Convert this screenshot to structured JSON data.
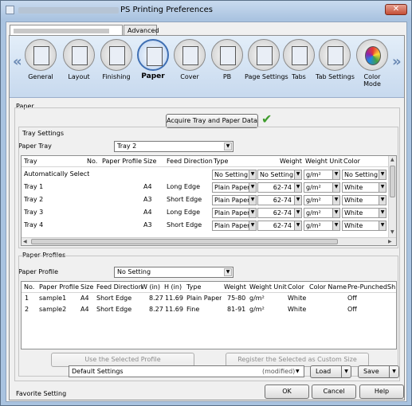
{
  "window": {
    "title": "PS Printing Preferences",
    "close_glyph": "✕"
  },
  "tabs": [
    {
      "label": "Advanced"
    }
  ],
  "iconbar": {
    "left_arrow": "«",
    "right_arrow": "»",
    "items": [
      {
        "label": "General"
      },
      {
        "label": "Layout"
      },
      {
        "label": "Finishing"
      },
      {
        "label": "Paper"
      },
      {
        "label": "Cover"
      },
      {
        "label": "PB"
      },
      {
        "label": "Page Settings"
      },
      {
        "label": "Tabs"
      },
      {
        "label": "Tab Settings"
      },
      {
        "label": "Color\nMode"
      }
    ]
  },
  "paper": {
    "group_label": "Paper",
    "acquire_button": "Acquire Tray and Paper Data",
    "check_glyph": "✔",
    "tray_settings_label": "Tray Settings",
    "paper_tray_label": "Paper Tray",
    "paper_tray_value": "Tray 2",
    "tray_table": {
      "columns": [
        "Tray",
        "No.",
        "Paper Profile",
        "Size",
        "Feed Direction",
        "Type",
        "Weight",
        "Weight Unit",
        "Color"
      ],
      "rows": [
        {
          "tray": "Automatically Select",
          "no": "",
          "profile": "",
          "size": "",
          "feed": "",
          "type": "No Setting",
          "weight": "No Setting",
          "unit": "g/m²",
          "color": "No Setting"
        },
        {
          "tray": "Tray 1",
          "no": "",
          "profile": "",
          "size": "A4",
          "feed": "Long Edge",
          "type": "Plain Paper",
          "weight": "62-74",
          "unit": "g/m²",
          "color": "White"
        },
        {
          "tray": "Tray 2",
          "no": "",
          "profile": "",
          "size": "A3",
          "feed": "Short Edge",
          "type": "Plain Paper",
          "weight": "62-74",
          "unit": "g/m²",
          "color": "White"
        },
        {
          "tray": "Tray 3",
          "no": "",
          "profile": "",
          "size": "A4",
          "feed": "Long Edge",
          "type": "Plain Paper",
          "weight": "62-74",
          "unit": "g/m²",
          "color": "White"
        },
        {
          "tray": "Tray 4",
          "no": "",
          "profile": "",
          "size": "A3",
          "feed": "Short Edge",
          "type": "Plain Paper",
          "weight": "62-74",
          "unit": "g/m²",
          "color": "White"
        }
      ]
    },
    "profiles_label": "Paper Profiles",
    "paper_profile_label": "Paper Profile",
    "paper_profile_value": "No Setting",
    "profile_table": {
      "columns": [
        "No.",
        "Paper Profile",
        "Size",
        "Feed Direction",
        "W (in)",
        "H (in)",
        "Type",
        "Weight",
        "Weight Unit",
        "Color",
        "Color Name",
        "Pre-Punched",
        "Sh"
      ],
      "rows": [
        {
          "no": "1",
          "profile": "sample1",
          "size": "A4",
          "feed": "Short Edge",
          "w": "8.27",
          "h": "11.69",
          "type": "Plain Paper",
          "weight": "75-80",
          "unit": "g/m²",
          "color": "White",
          "cname": "",
          "punched": "Off"
        },
        {
          "no": "2",
          "profile": "sample2",
          "size": "A4",
          "feed": "Short Edge",
          "w": "8.27",
          "h": "11.69",
          "type": "Fine",
          "weight": "81-91",
          "unit": "g/m²",
          "color": "White",
          "cname": "",
          "punched": "Off"
        }
      ]
    },
    "use_selected": "Use the Selected Profile",
    "register_selected": "Register the Selected as Custom Size"
  },
  "footer": {
    "favorite_label": "Favorite Setting",
    "favorite_value": "Default Settings",
    "modified": "(modified)",
    "load": "Load",
    "save": "Save",
    "ok": "OK",
    "cancel": "Cancel",
    "help": "Help"
  },
  "colors": {
    "selected_icon": "#3f6fb3",
    "check": "#3e9c2c",
    "titlebar": "#a9c3e0"
  }
}
